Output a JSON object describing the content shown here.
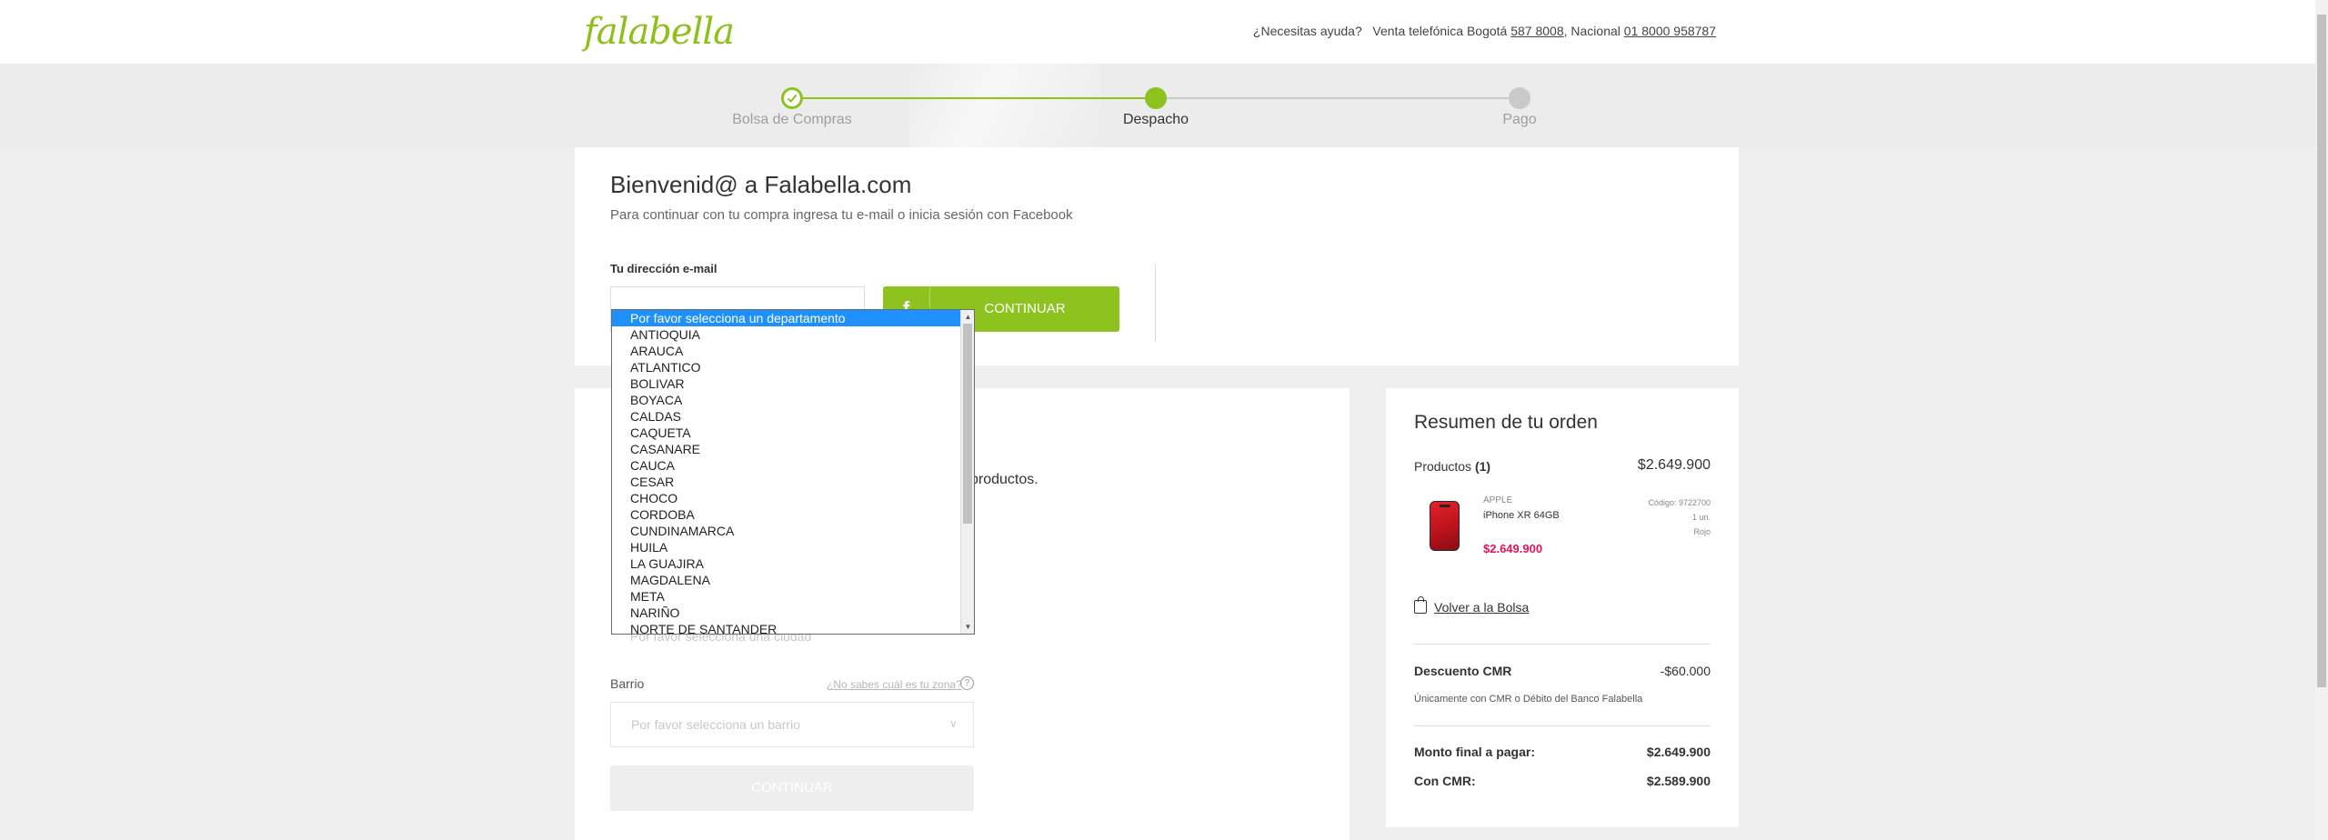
{
  "header": {
    "logo": "falabella",
    "help_question": "¿Necesitas ayuda?",
    "sales_label": "Venta telefónica Bogotá",
    "phone_bogota": "587 8008",
    "national_label": ", Nacional",
    "phone_national": "01 8000 958787"
  },
  "steps": [
    {
      "label": "Bolsa de Compras",
      "status": "done"
    },
    {
      "label": "Despacho",
      "status": "current"
    },
    {
      "label": "Pago",
      "status": "pending"
    }
  ],
  "welcome": {
    "title": "Bienvenid@ a Falabella.com",
    "subtitle": "Para continuar con tu compra ingresa tu e-mail o inicia sesión con Facebook",
    "email_label": "Tu dirección e-mail",
    "facebook_glyph": "f",
    "continue_label": "CONTINUAR"
  },
  "shipping": {
    "partial_text": "productos.",
    "ciudad_placeholder": "Por favor selecciona una ciudad",
    "barrio_label": "Barrio",
    "zona_help_link": "¿No sabes cuál es tu zona?",
    "barrio_placeholder": "Por favor selecciona un barrio",
    "continue_label": "CONTINUAR"
  },
  "department_dropdown": {
    "selected": "Por favor selecciona un departamento",
    "options": [
      "Por favor selecciona un departamento",
      "ANTIOQUIA",
      "ARAUCA",
      "ATLANTICO",
      "BOLIVAR",
      "BOYACA",
      "CALDAS",
      "CAQUETA",
      "CASANARE",
      "CAUCA",
      "CESAR",
      "CHOCO",
      "CORDOBA",
      "CUNDINAMARCA",
      "HUILA",
      "LA GUAJIRA",
      "MAGDALENA",
      "META",
      "NARIÑO",
      "NORTE DE SANTANDER"
    ]
  },
  "summary": {
    "title": "Resumen de tu orden",
    "products_label": "Productos",
    "products_count": "(1)",
    "products_total": "$2.649.900",
    "item": {
      "brand": "APPLE",
      "name": "iPhone XR 64GB",
      "price": "$2.649.900",
      "code": "Código: 9722700",
      "quantity": "1 un.",
      "color": "Rojo"
    },
    "back_to_bag": "Volver a la Bolsa",
    "discount_label": "Descuento CMR",
    "discount_value": "-$60.000",
    "cmr_note": "Únicamente con CMR o Débito del Banco Falabella",
    "final_label": "Monto final a pagar:",
    "final_value": "$2.649.900",
    "cmr_label": "Con CMR:",
    "cmr_value": "$2.589.900"
  },
  "colors": {
    "brand_green": "#8dc21f",
    "price_pink": "#e2135a",
    "selection_blue": "#1e90ff"
  }
}
